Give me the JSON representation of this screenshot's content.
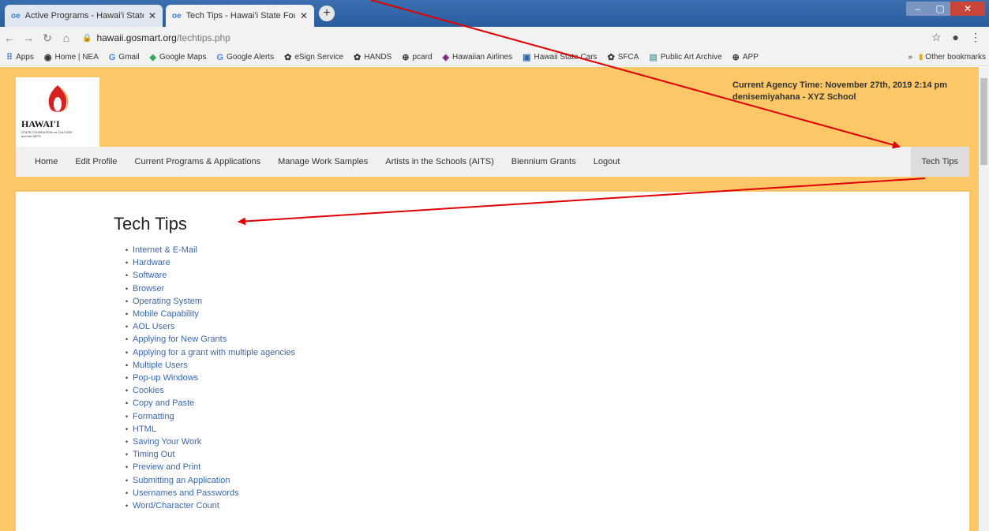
{
  "browser": {
    "tabs": [
      {
        "label": "Active Programs - Hawai'i State F",
        "favicon": "oe"
      },
      {
        "label": "Tech Tips - Hawai'i State Founda",
        "favicon": "oe"
      }
    ],
    "new_tab": "+",
    "url_host": "hawaii.gosmart.org",
    "url_path": "/techtips.php",
    "bookmarks": [
      {
        "icon": "apps-icon",
        "label": "Apps"
      },
      {
        "icon": "nea-icon",
        "label": "Home | NEA"
      },
      {
        "icon": "google-icon",
        "label": "Gmail"
      },
      {
        "icon": "maps-icon",
        "label": "Google Maps"
      },
      {
        "icon": "google-icon",
        "label": "Google Alerts"
      },
      {
        "icon": "gear-icon",
        "label": "eSign Service"
      },
      {
        "icon": "gear-icon",
        "label": "HANDS"
      },
      {
        "icon": "globe-icon",
        "label": "pcard"
      },
      {
        "icon": "airline-icon",
        "label": "Hawaiian Airlines"
      },
      {
        "icon": "car-icon",
        "label": "Hawaii State Cars"
      },
      {
        "icon": "gear-icon",
        "label": "SFCA"
      },
      {
        "icon": "archive-icon",
        "label": "Public Art Archive"
      },
      {
        "icon": "globe-icon",
        "label": "APP"
      }
    ],
    "more_bookmarks": "»",
    "other_bookmarks": "Other bookmarks"
  },
  "header": {
    "logo_word": "HAWAI'I",
    "logo_sub": "STATE FOUNDATION on CULTURE and the ARTS",
    "agency_time": "Current Agency Time: November 27th, 2019 2:14 pm",
    "user": "denisemiyahana - XYZ School"
  },
  "nav": {
    "items": [
      "Home",
      "Edit Profile",
      "Current Programs & Applications",
      "Manage Work Samples",
      "Artists in the Schools (AITS)",
      "Biennium Grants",
      "Logout"
    ],
    "right_item": "Tech Tips"
  },
  "main": {
    "title": "Tech Tips",
    "tips": [
      "Internet & E-Mail",
      "Hardware",
      "Software",
      "Browser",
      "Operating System",
      "Mobile Capability",
      "AOL Users",
      "Applying for New Grants",
      "Applying for a grant with multiple agencies",
      "Multiple Users",
      "Pop-up Windows",
      "Cookies",
      "Copy and Paste",
      "Formatting",
      "HTML",
      "Saving Your Work",
      "Timing Out",
      "Preview and Print",
      "Submitting an Application",
      "Usernames and Passwords",
      "Word/Character Count"
    ]
  },
  "colors": {
    "header_bg": "#fcc766",
    "link": "#3a67a8",
    "annotation_arrow": "#e00000"
  }
}
